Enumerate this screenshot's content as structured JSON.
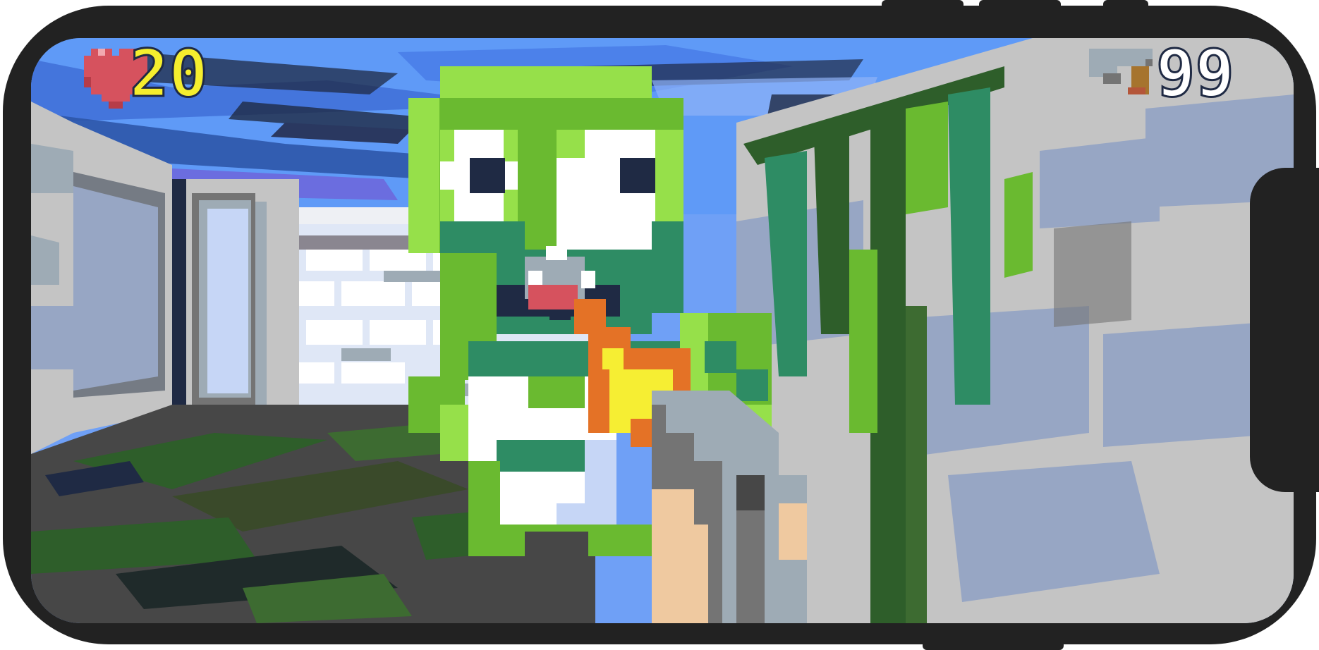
{
  "hud": {
    "health": "20",
    "ammo": "99",
    "health_icon": "heart-icon",
    "ammo_icon": "gun-icon"
  },
  "colors": {
    "device_frame": "#222222",
    "ceiling_light": "#5f9af7",
    "ceiling_dark": "#1f2a44",
    "wall_light": "#c4c4c4",
    "wall_blue": "#97a6c4",
    "floor_dark": "#474747",
    "moss_green": "#2e5e2a",
    "monster_green": "#6aba30",
    "monster_light": "#96e04a",
    "monster_teal": "#2e8c64",
    "fire_orange": "#e47226",
    "fire_yellow": "#f6ee33",
    "hud_yellow": "#f5ee2e",
    "heart_red": "#d6525e"
  },
  "scene": {
    "enemy": "green-monster",
    "effect": "fire-breath",
    "weapon": "pixel-pistol"
  }
}
